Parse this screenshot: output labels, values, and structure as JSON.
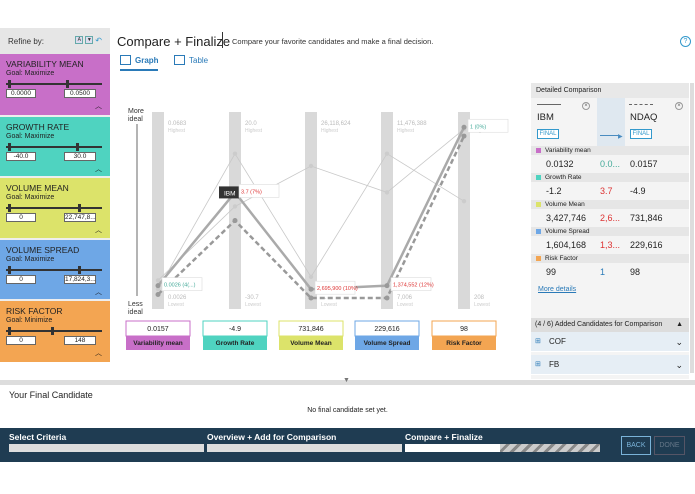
{
  "refine": {
    "label": "Refine by:",
    "criteria": [
      {
        "name": "VARIABILITY MEAN",
        "goal": "Goal: Maximize",
        "min": "0.0000",
        "max": "0.0500",
        "color": "#c86fc8"
      },
      {
        "name": "GROWTH RATE",
        "goal": "Goal: Maximize",
        "min": "-40.0",
        "max": "30.0",
        "color": "#4fd3c0"
      },
      {
        "name": "VOLUME MEAN",
        "goal": "Goal: Maximize",
        "min": "0",
        "max": "22,747,8...",
        "color": "#dce36a"
      },
      {
        "name": "VOLUME SPREAD",
        "goal": "Goal: Maximize",
        "min": "0",
        "max": "17,824,3...",
        "color": "#6ea7e6"
      },
      {
        "name": "RISK FACTOR",
        "goal": "Goal: Minimize",
        "min": "0",
        "max": "148",
        "color": "#f3a552"
      }
    ]
  },
  "header": {
    "title": "Compare + Finalize",
    "subtitle": "Compare your favorite candidates and make a final decision.",
    "help": "?"
  },
  "tabs": [
    {
      "label": "Graph",
      "active": true
    },
    {
      "label": "Table",
      "active": false
    }
  ],
  "chart_data": {
    "type": "line",
    "y_top_label": [
      "More",
      "ideal"
    ],
    "y_bottom_label": [
      "Less",
      "ideal"
    ],
    "axes": [
      {
        "name": "Variability mean",
        "current": "0.0157",
        "highest": "0.0683",
        "lowest": "0.0026",
        "color": "#c86fc8"
      },
      {
        "name": "Growth Rate",
        "current": "-4.9",
        "highest": "20.0",
        "lowest": "-30.7",
        "color": "#4fd3c0"
      },
      {
        "name": "Volume Mean",
        "current": "731,846",
        "highest": "26,118,624",
        "lowest": "...",
        "color": "#dce36a"
      },
      {
        "name": "Volume Spread",
        "current": "229,616",
        "highest": "11,476,388",
        "lowest": "7,006",
        "color": "#6ea7e6"
      },
      {
        "name": "Risk Factor",
        "current": "98",
        "highest": "80",
        "lowest": "208",
        "color": "#f3a552"
      }
    ],
    "highest_word": "Highest",
    "lowest_word": "Lowest",
    "series": [
      {
        "name": "IBM",
        "values": [
          0.07,
          0.6,
          0.05,
          0.07,
          0.97
        ]
      },
      {
        "name": "NDAQ",
        "values": [
          0.02,
          0.44,
          0.0,
          0.0,
          0.92
        ]
      },
      {
        "values": [
          0.05,
          0.82,
          0.12,
          0.82,
          0.55
        ]
      },
      {
        "values": [
          0.1,
          0.52,
          0.75,
          0.6,
          0.96
        ]
      }
    ],
    "annotations": [
      {
        "axis": 0,
        "text": "0.0026 (4(...)",
        "color": "#4a9"
      },
      {
        "axis": 1,
        "text": "3.7 (7%)",
        "color": "#d33"
      },
      {
        "axis": 2,
        "text": "2,695,900 (10%)",
        "color": "#d33"
      },
      {
        "axis": 3,
        "text": "1,374,552 (12%)",
        "color": "#d33"
      },
      {
        "axis": 4,
        "text": "1 (0%)",
        "color": "#4a9"
      }
    ],
    "tag": "IBM"
  },
  "detail": {
    "title": "Detailed Comparison",
    "left": {
      "name": "IBM",
      "final": "FINAL"
    },
    "right": {
      "name": "NDAQ",
      "final": "FINAL"
    },
    "metrics": [
      {
        "label": "Variability mean",
        "left": "0.0132",
        "diff": "0.0...",
        "right": "0.0157",
        "color": "#c86fc8",
        "diff_color": "#4a9"
      },
      {
        "label": "Growth Rate",
        "left": "-1.2",
        "diff": "3.7",
        "right": "-4.9",
        "color": "#4fd3c0",
        "diff_color": "#d33"
      },
      {
        "label": "Volume Mean",
        "left": "3,427,746",
        "diff": "2,6...",
        "right": "731,846",
        "color": "#dce36a",
        "diff_color": "#d33"
      },
      {
        "label": "Volume Spread",
        "left": "1,604,168",
        "diff": "1,3...",
        "right": "229,616",
        "color": "#6ea7e6",
        "diff_color": "#d33"
      },
      {
        "label": "Risk Factor",
        "left": "99",
        "diff": "1",
        "right": "98",
        "color": "#f3a552",
        "diff_color": "#2a7ab8"
      }
    ],
    "more": "More details",
    "added_title": "(4 / 6) Added Candidates for Comparison",
    "added": [
      "COF",
      "FB"
    ]
  },
  "final": {
    "title": "Your Final Candidate",
    "empty": "No final candidate set yet."
  },
  "progress": {
    "steps": [
      "Select Criteria",
      "Overview + Add for Comparison",
      "Compare + Finalize"
    ],
    "back": "BACK",
    "done": "DONE"
  }
}
